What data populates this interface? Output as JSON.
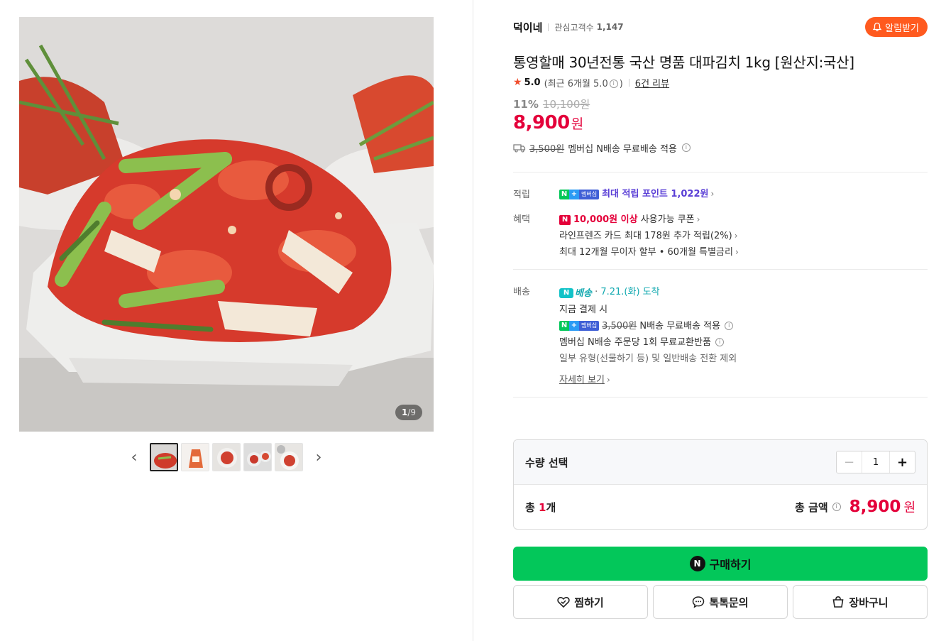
{
  "gallery": {
    "counter_current": "1",
    "counter_total": "/9",
    "prev_icon": "chevron-left-icon",
    "next_icon": "chevron-right-icon",
    "thumbnail_count": 5
  },
  "store": {
    "name": "덕이네",
    "fans_label": "관심고객수",
    "fans_count": "1,147",
    "alarm_label": "알림받기"
  },
  "product": {
    "title": "통영할매 30년전통 국산 명품 대파김치 1kg [원산지:국산]",
    "rating": "5.0",
    "rating_sub_a": "(최근 6개월 5.0",
    "rating_sub_b": ")",
    "review_link": "6건 리뷰",
    "discount": "11%",
    "original_price": "10,100원",
    "price": "8,900",
    "price_unit": "원",
    "ship_fee_struck": "3,500원",
    "ship_note": "멤버십 N배송 무료배송 적용"
  },
  "benefits": {
    "point_label": "적립",
    "point_text": "최대 적립 포인트",
    "point_value": "1,022원",
    "benefit_label": "혜택",
    "coupon_red": "10,000원 이상",
    "coupon_text": "사용가능 쿠폰",
    "card_text": "라인프렌즈 카드 최대 178원 추가 적립(2%)",
    "installment_text": "최대 12개월 무이자 할부 • 60개월 특별금리"
  },
  "delivery": {
    "label": "배송",
    "badge": "배송",
    "dot": "·",
    "arrival": "7.21.(화) 도착",
    "pay_now": "지금 결제 시",
    "fee_struck": "3,500원",
    "fee_note": "N배송 무료배송 적용",
    "exchange": "멤버십 N배송 주문당 1회 무료교환반품",
    "exclusion": "일부 유형(선물하기 등) 및 일반배송 전환 제외",
    "more": "자세히 보기"
  },
  "membership_badge": {
    "n": "N",
    "plus": "+",
    "text": "멤버십"
  },
  "quantity": {
    "label": "수량 선택",
    "value": "1",
    "minus": "−",
    "plus": "+",
    "total_prefix": "총 ",
    "total_count": "1",
    "total_suffix": "개",
    "total_amount_label": "총 금액",
    "total_price": "8,900",
    "total_unit": "원"
  },
  "actions": {
    "buy": "구매하기",
    "wish": "찜하기",
    "talk": "톡톡문의",
    "cart": "장바구니"
  },
  "colors": {
    "accent_green": "#03c75a",
    "price_red": "#e4003a",
    "alarm_orange": "#ff5a1f",
    "membership_purple": "#5a3fd6",
    "delivery_teal": "#12a9b0"
  }
}
